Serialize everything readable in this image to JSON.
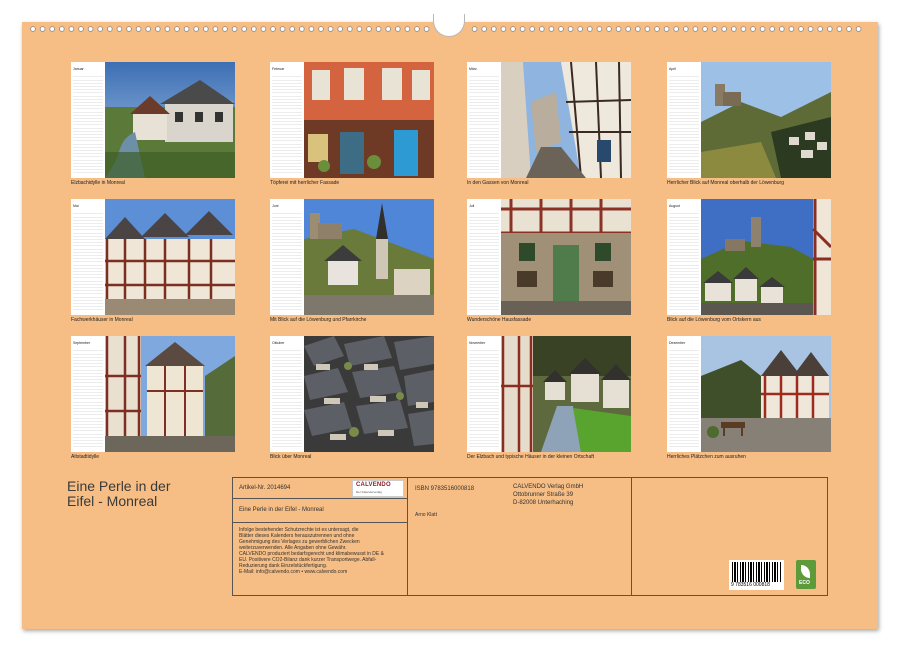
{
  "calendar": {
    "title": "Eine Perle in der Eifel - Monreal",
    "title_line1": "Eine Perle in der",
    "title_line2": "Eifel - Monreal",
    "months": [
      {
        "name": "Januar",
        "caption": "Elzbachidylle in Monreal"
      },
      {
        "name": "Februar",
        "caption": "Töpferei mit herrlicher Fassade"
      },
      {
        "name": "März",
        "caption": "In den Gassen von Monreal"
      },
      {
        "name": "April",
        "caption": "Herrlicher Blick auf Monreal oberhalb der Löwenburg"
      },
      {
        "name": "Mai",
        "caption": "Fachwerkhäuser in Monreal"
      },
      {
        "name": "Juni",
        "caption": "Mit Blick auf die Löwenburg und Pfarrkirche"
      },
      {
        "name": "Juli",
        "caption": "Wunderschöne Hausfassade"
      },
      {
        "name": "August",
        "caption": "Blick auf die Löwenburg vom Ortskern aus"
      },
      {
        "name": "September",
        "caption": "Altstadtidylle"
      },
      {
        "name": "Oktober",
        "caption": "Blick über Monreal"
      },
      {
        "name": "November",
        "caption": "Der Elzbach und typische Häuser in der kleinen Ortschaft"
      },
      {
        "name": "Dezember",
        "caption": "Herrliches Plätzchen zum ausruhen"
      }
    ]
  },
  "info": {
    "article": "Artikel-Nr. 2014694",
    "logo": "CALVENDO",
    "logo_sub": "Der Kalenderverlag",
    "product_title": "Eine Perle in der Eifel - Monreal",
    "legal_lines": [
      "Infolge bestehender Schutzrechte ist es untersagt, die",
      "Blätter dieses Kalenders herauszutrennen und ohne",
      "Genehmigung des Verlages zu gewerblichen Zwecken",
      "weiterzuverwenden. Alle Angaben ohne Gewähr.",
      "CALVENDO produziert bedarfsgerecht und klimabewusst in DE &",
      "EU. Positivere CO2-Bilanz dank kurzer Transportwege. Abfall-",
      "Reduzierung dank Einzelstückfertigung.",
      "E-Mail: info@calvendo.com • www.calvendo.com"
    ],
    "isbn": "ISBN 9783516000818",
    "author": "Arno Klatt",
    "publisher_lines": [
      "CALVENDO Verlag GmbH",
      "Ottobrunner Straße 39",
      "D-82008 Unterhaching"
    ],
    "barcode_number": "9 783516 000818",
    "eco_label": "ECO"
  },
  "colors": {
    "background": "#f6bd84",
    "border": "#555555"
  }
}
